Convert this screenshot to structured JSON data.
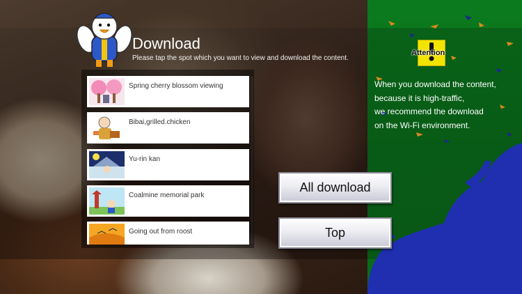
{
  "header": {
    "title": "Download",
    "subtitle": "Please tap the spot which you want to view and download the content."
  },
  "list": [
    {
      "label": "Spring cherry blossom viewing",
      "icon": "cherry-blossom-thumbnail"
    },
    {
      "label": "Bibai,grilled.chicken",
      "icon": "grilled-chicken-thumbnail"
    },
    {
      "label": "Yu-rin kan",
      "icon": "yurinkan-thumbnail"
    },
    {
      "label": "Coalmine memorial park",
      "icon": "coalmine-park-thumbnail"
    },
    {
      "label": "Going out from roost",
      "icon": "roost-thumbnail"
    }
  ],
  "buttons": {
    "all_download": "All download",
    "top": "Top"
  },
  "attention": {
    "label": "Attention",
    "lines": [
      "When you download the content,",
      "because it is high-traffic,",
      "we recommend the download",
      "on the Wi-Fi environment."
    ]
  },
  "colors": {
    "panel_green": "#0b7a1e",
    "attention_yellow": "#f3e400",
    "splash_blue": "#1f2fb0"
  }
}
